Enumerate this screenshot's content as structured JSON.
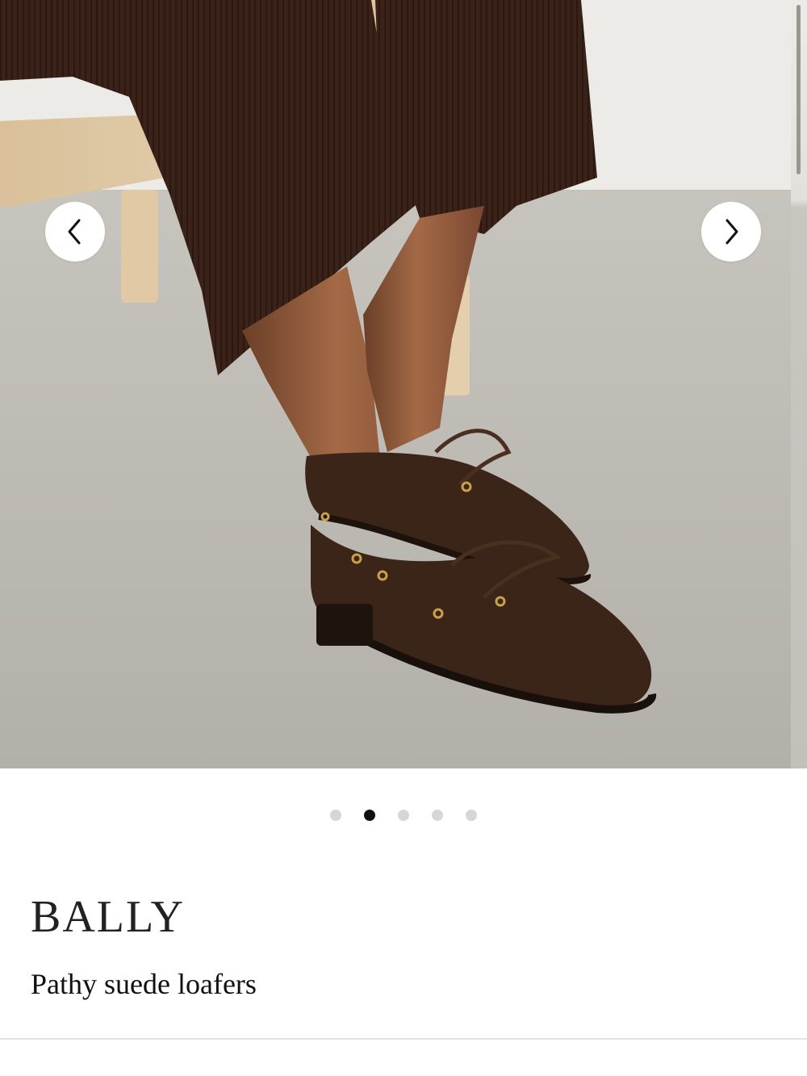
{
  "product": {
    "brand": "BALLY",
    "name": "Pathy suede loafers"
  },
  "gallery": {
    "image_count": 5,
    "active_index": 1,
    "prev_icon": "chevron-left-icon",
    "next_icon": "chevron-right-icon"
  },
  "colors": {
    "active_dot": "#111111",
    "inactive_dot": "#d6d6d6",
    "brand_text": "#222222",
    "floor": "#b9b6b0",
    "wall": "#ecebe8",
    "trousers": "#3a2219",
    "suede": "#3b2418"
  }
}
